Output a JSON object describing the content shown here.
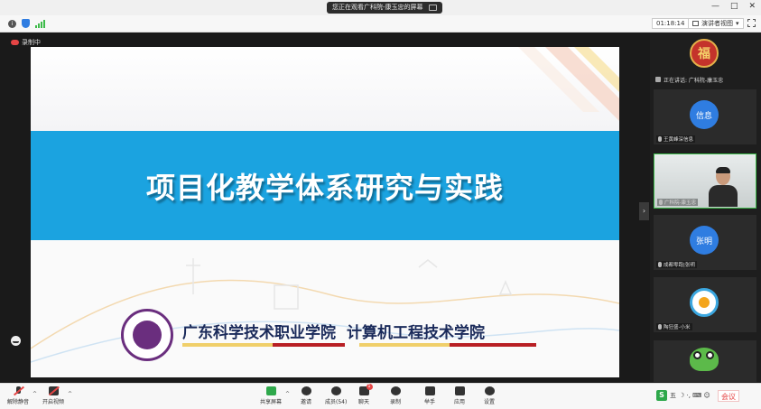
{
  "titlebar": {
    "share_notice": "您正在观看广科院-康玉忠的屏幕",
    "window_controls": [
      "—",
      "□",
      "✕"
    ]
  },
  "subbar": {
    "timer": "01:18:14",
    "view_label": "演讲者视图",
    "view_caret": "▾"
  },
  "recording": {
    "label": "录制中"
  },
  "slide": {
    "title": "项目化教学体系研究与实践",
    "school_name": "广东科学技术职业学院",
    "college_name": "计算机工程技术学院",
    "colors": {
      "band": "#1ba3e0",
      "purple": "#6a2e7e",
      "red": "#b81f24",
      "yellow": "#f0cf6a"
    }
  },
  "panel": {
    "speaking_label": "正在讲话: 广科院-康玉忠",
    "tiles": [
      {
        "avatar_text": "福",
        "label": ""
      },
      {
        "avatar_text": "信息",
        "label": "王黄峰深信息"
      },
      {
        "avatar_text": "",
        "label": "广科院-康玉忠"
      },
      {
        "avatar_text": "张明",
        "label": "成都零跑|张明"
      },
      {
        "avatar_text": "",
        "label": "陶狂盛-小米"
      },
      {
        "avatar_text": "",
        "label": ""
      }
    ],
    "collapse_arrow": "›"
  },
  "toolbar": {
    "unmute": "解除静音",
    "start_video": "开启视频",
    "share_screen": "共享屏幕",
    "invite": "邀请",
    "participants": "成员(54)",
    "chat": "聊天",
    "chat_badge": "1",
    "record": "录制",
    "raise_hand": "举手",
    "apps": "应用",
    "settings": "设置",
    "caret": "^",
    "ime_label": "五",
    "ime_extra": "☽ ·, ⌨ ☺",
    "end_meeting": "会议"
  }
}
